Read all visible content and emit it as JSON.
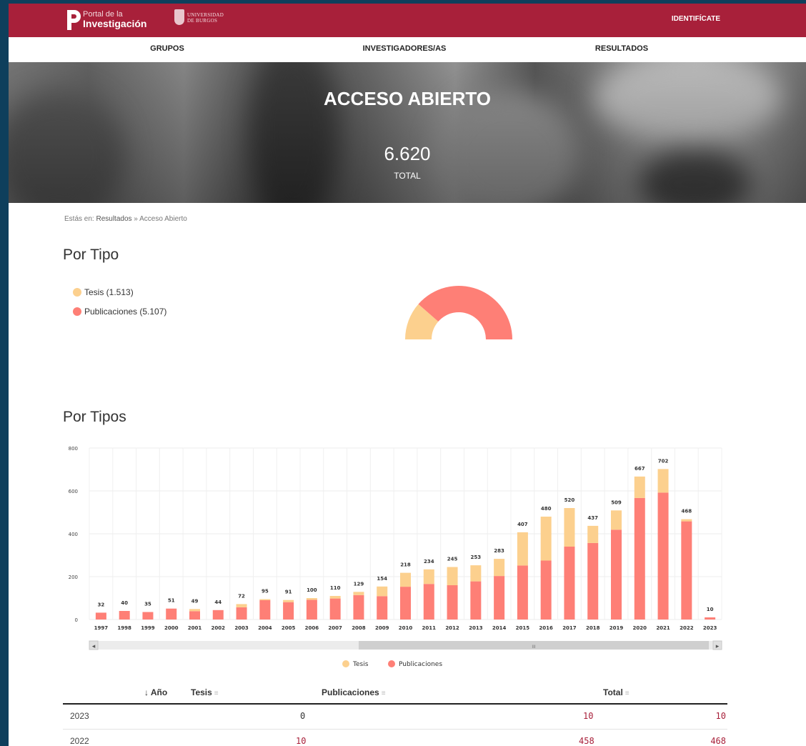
{
  "header": {
    "logo_small": "Portal de la",
    "logo_big": "Investigación",
    "university": [
      "UNIVERSIDAD",
      "DE BURGOS"
    ],
    "login_label": "IDENTIFÍCATE"
  },
  "nav": {
    "items": [
      "GRUPOS",
      "INVESTIGADORES/AS",
      "RESULTADOS"
    ]
  },
  "hero": {
    "title": "ACCESO ABIERTO",
    "total_value": "6.620",
    "total_label": "TOTAL"
  },
  "breadcrumb": {
    "prefix": "Estás en:",
    "items": [
      "Resultados",
      "Acceso Abierto"
    ],
    "separator": "»"
  },
  "por_tipo": {
    "heading": "Por Tipo",
    "legend": [
      {
        "label": "Tesis (1.513)"
      },
      {
        "label": "Publicaciones (5.107)"
      }
    ]
  },
  "por_tipos": {
    "heading": "Por Tipos"
  },
  "colors": {
    "tesis": "#fcd08e",
    "publicaciones": "#fe7f76",
    "brand": "#a8203a"
  },
  "chart_data": [
    {
      "type": "pie",
      "variant": "semi-donut",
      "categories": [
        "Tesis",
        "Publicaciones"
      ],
      "values": [
        1513,
        5107
      ]
    },
    {
      "type": "bar",
      "stacked": true,
      "categories": [
        "1997",
        "1998",
        "1999",
        "2000",
        "2001",
        "2002",
        "2003",
        "2004",
        "2005",
        "2006",
        "2007",
        "2008",
        "2009",
        "2010",
        "2011",
        "2012",
        "2013",
        "2014",
        "2015",
        "2016",
        "2017",
        "2018",
        "2019",
        "2020",
        "2021",
        "2022",
        "2023"
      ],
      "series": [
        {
          "name": "Tesis",
          "values": [
            0,
            0,
            0,
            0,
            10,
            0,
            15,
            5,
            10,
            8,
            12,
            15,
            45,
            65,
            68,
            85,
            75,
            80,
            155,
            205,
            180,
            80,
            90,
            100,
            110,
            10,
            0
          ]
        },
        {
          "name": "Publicaciones",
          "values": [
            32,
            40,
            35,
            51,
            39,
            44,
            57,
            90,
            81,
            92,
            98,
            114,
            109,
            153,
            166,
            160,
            178,
            203,
            252,
            275,
            340,
            357,
            419,
            567,
            592,
            458,
            10
          ]
        }
      ],
      "totals": [
        32,
        40,
        35,
        51,
        49,
        44,
        72,
        95,
        91,
        100,
        110,
        129,
        154,
        218,
        234,
        245,
        253,
        283,
        407,
        480,
        520,
        437,
        509,
        667,
        702,
        468,
        10
      ],
      "ylim": [
        0,
        800
      ],
      "yticks": [
        0,
        200,
        400,
        600,
        800
      ],
      "grid": true,
      "legend": "bottom"
    }
  ],
  "scrollbar": {
    "left_arrow": "◂",
    "right_arrow": "▸",
    "grip": "III"
  },
  "table": {
    "headers": {
      "year": "↓ Año",
      "tesis": "Tesis",
      "publicaciones": "Publicaciones",
      "total": "Total"
    },
    "rows": [
      {
        "year": "2023",
        "tesis": "0",
        "publicaciones": "10",
        "total": "10"
      },
      {
        "year": "2022",
        "tesis": "10",
        "publicaciones": "458",
        "total": "468"
      }
    ]
  }
}
